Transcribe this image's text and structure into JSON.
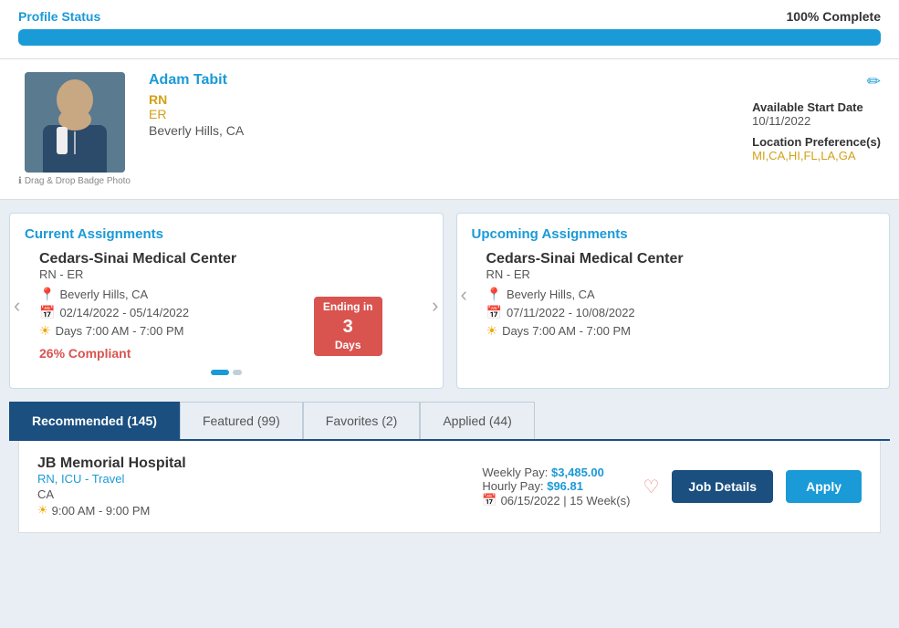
{
  "profile_status": {
    "label": "Profile Status",
    "percent_label": "100% Complete",
    "percent": 100
  },
  "profile": {
    "name": "Adam Tabit",
    "role": "RN",
    "department": "ER",
    "location": "Beverly Hills, CA",
    "available_start_date_label": "Available Start Date",
    "available_start_date": "10/11/2022",
    "location_preference_label": "Location Preference(s)",
    "location_preference": "MI,CA,HI,FL,LA,GA",
    "drag_drop_label": "Drag & Drop Badge Photo"
  },
  "current_assignments": {
    "title": "Current Assignments",
    "facility": "Cedars-Sinai Medical Center",
    "role": "RN - ER",
    "location": "Beverly Hills, CA",
    "dates": "02/14/2022 - 05/14/2022",
    "shift": "Days 7:00 AM - 7:00 PM",
    "ending_badge_line1": "Ending in",
    "ending_badge_days": "3",
    "ending_badge_line2": "Days",
    "compliant": "26% Compliant"
  },
  "upcoming_assignments": {
    "title": "Upcoming Assignments",
    "facility": "Cedars-Sinai Medical Center",
    "role": "RN - ER",
    "location": "Beverly Hills, CA",
    "dates": "07/11/2022 - 10/08/2022",
    "shift": "Days 7:00 AM - 7:00 PM"
  },
  "tabs": [
    {
      "label": "Recommended (145)",
      "active": true
    },
    {
      "label": "Featured (99)",
      "active": false
    },
    {
      "label": "Favorites (2)",
      "active": false
    },
    {
      "label": "Applied (44)",
      "active": false
    }
  ],
  "job_card": {
    "name": "JB Memorial Hospital",
    "role": "RN, ICU - Travel",
    "location": "CA",
    "shift": "9:00 AM - 9:00 PM",
    "weekly_pay_label": "Weekly Pay:",
    "weekly_pay": "$3,485.00",
    "hourly_pay_label": "Hourly Pay:",
    "hourly_pay": "$96.81",
    "date_weeks": "06/15/2022 | 15 Week(s)",
    "btn_details": "Job Details",
    "btn_apply": "Apply"
  },
  "icons": {
    "location": "📍",
    "calendar": "📅",
    "sun": "☀",
    "heart": "♡",
    "edit": "✏",
    "info": "ℹ"
  }
}
